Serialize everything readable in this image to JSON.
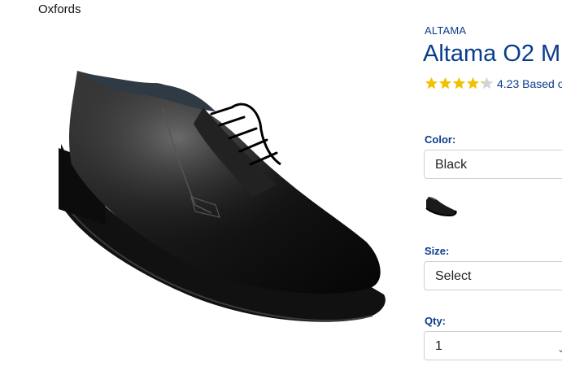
{
  "breadcrumb": {
    "current": "Oxfords"
  },
  "product": {
    "brand": "ALTAMA",
    "title": "Altama O2 M",
    "rating": {
      "value": 4.23,
      "stars_filled": 4.23,
      "stars_total": 5,
      "text": "4.23 Based o"
    }
  },
  "options": {
    "color": {
      "label": "Color:",
      "selected": "Black",
      "swatch_icon": "black-oxford-shoe-swatch"
    },
    "size": {
      "label": "Size:",
      "selected": "Select"
    },
    "qty": {
      "label": "Qty:",
      "selected": "1"
    }
  },
  "colors": {
    "brand_blue": "#0a3d8c",
    "star_gold": "#f2c200",
    "star_empty": "#d3d3d3"
  }
}
